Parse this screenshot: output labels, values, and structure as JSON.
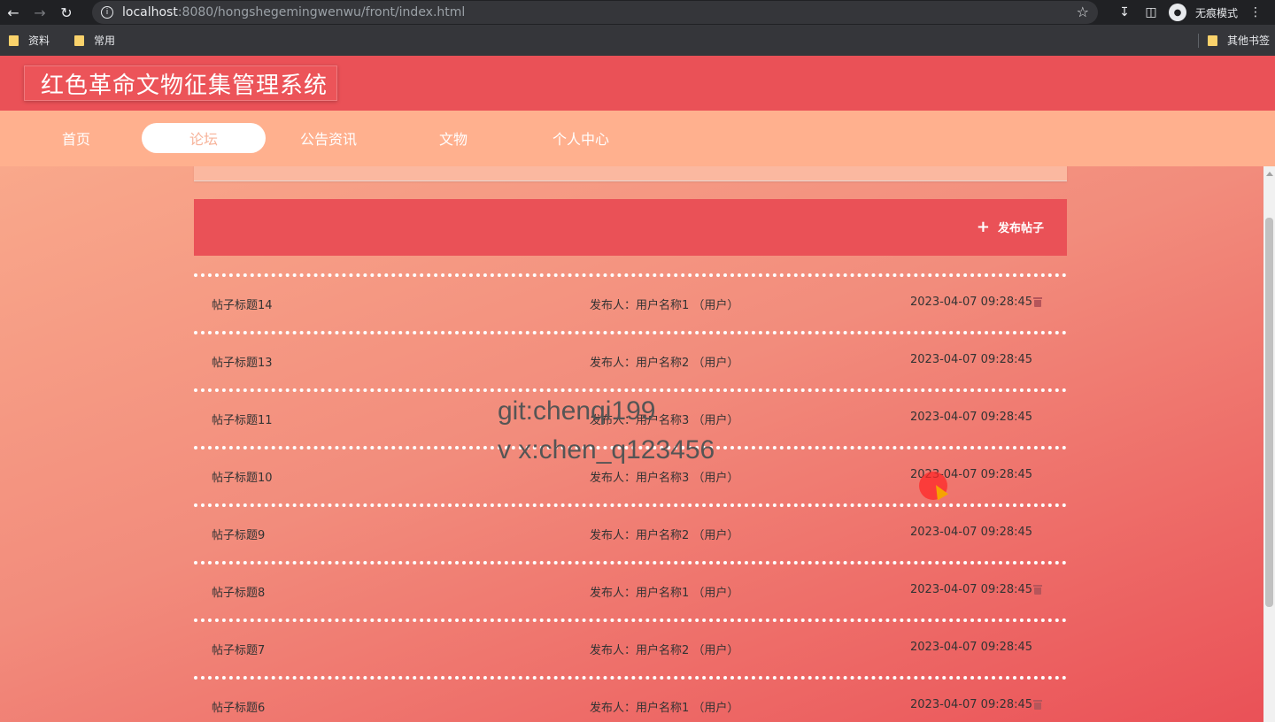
{
  "browser": {
    "url_host": "localhost",
    "url_rest": ":8080/hongshegemingwenwu/front/index.html",
    "incognito_label": "无痕模式",
    "bookmarks": [
      "资料",
      "常用"
    ],
    "other_bookmarks": "其他书签"
  },
  "site": {
    "title": "红色革命文物征集管理系统",
    "nav": [
      "首页",
      "论坛",
      "公告资讯",
      "文物",
      "个人中心"
    ],
    "active_nav": "论坛"
  },
  "forum": {
    "publish_label": "发布帖子",
    "posts": [
      {
        "title": "帖子标题14",
        "author": "发布人：用户名称1 （用户）",
        "date": "2023-04-07 09:28:45",
        "deletable": true
      },
      {
        "title": "帖子标题13",
        "author": "发布人：用户名称2 （用户）",
        "date": "2023-04-07 09:28:45",
        "deletable": false
      },
      {
        "title": "帖子标题11",
        "author": "发布人：用户名称3 （用户）",
        "date": "2023-04-07 09:28:45",
        "deletable": false
      },
      {
        "title": "帖子标题10",
        "author": "发布人：用户名称3 （用户）",
        "date": "2023-04-07 09:28:45",
        "deletable": false
      },
      {
        "title": "帖子标题9",
        "author": "发布人：用户名称2 （用户）",
        "date": "2023-04-07 09:28:45",
        "deletable": false
      },
      {
        "title": "帖子标题8",
        "author": "发布人：用户名称1 （用户）",
        "date": "2023-04-07 09:28:45",
        "deletable": true
      },
      {
        "title": "帖子标题7",
        "author": "发布人：用户名称2 （用户）",
        "date": "2023-04-07 09:28:45",
        "deletable": false
      },
      {
        "title": "帖子标题6",
        "author": "发布人：用户名称1 （用户）",
        "date": "2023-04-07 09:28:45",
        "deletable": true
      }
    ]
  },
  "watermark": {
    "line1": "git:chenqi199",
    "line2": "v x:chen_q123456"
  },
  "colors": {
    "header": "#ea5157",
    "nav_bar": "#ffb08e",
    "accent": "#ea5157"
  }
}
